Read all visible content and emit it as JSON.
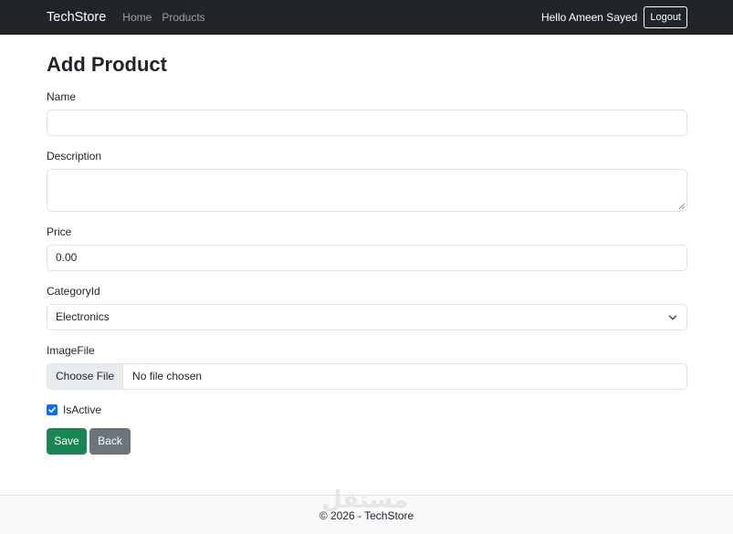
{
  "navbar": {
    "brand": "TechStore",
    "links": [
      "Home",
      "Products"
    ],
    "greeting": "Hello Ameen Sayed",
    "logout_label": "Logout"
  },
  "page": {
    "title": "Add Product"
  },
  "form": {
    "name": {
      "label": "Name",
      "value": ""
    },
    "description": {
      "label": "Description",
      "value": ""
    },
    "price": {
      "label": "Price",
      "value": "0.00"
    },
    "category": {
      "label": "CategoryId",
      "selected": "Electronics"
    },
    "image": {
      "label": "ImageFile",
      "button": "Choose File",
      "status": "No file chosen"
    },
    "is_active": {
      "label": "IsActive",
      "checked": true
    },
    "save_label": "Save",
    "back_label": "Back"
  },
  "footer": {
    "text": "© 2026 - TechStore",
    "watermark": "مستقل"
  },
  "colors": {
    "navbar_bg": "#212529",
    "primary": "#0d6efd",
    "success": "#198754",
    "secondary": "#6c757d"
  }
}
